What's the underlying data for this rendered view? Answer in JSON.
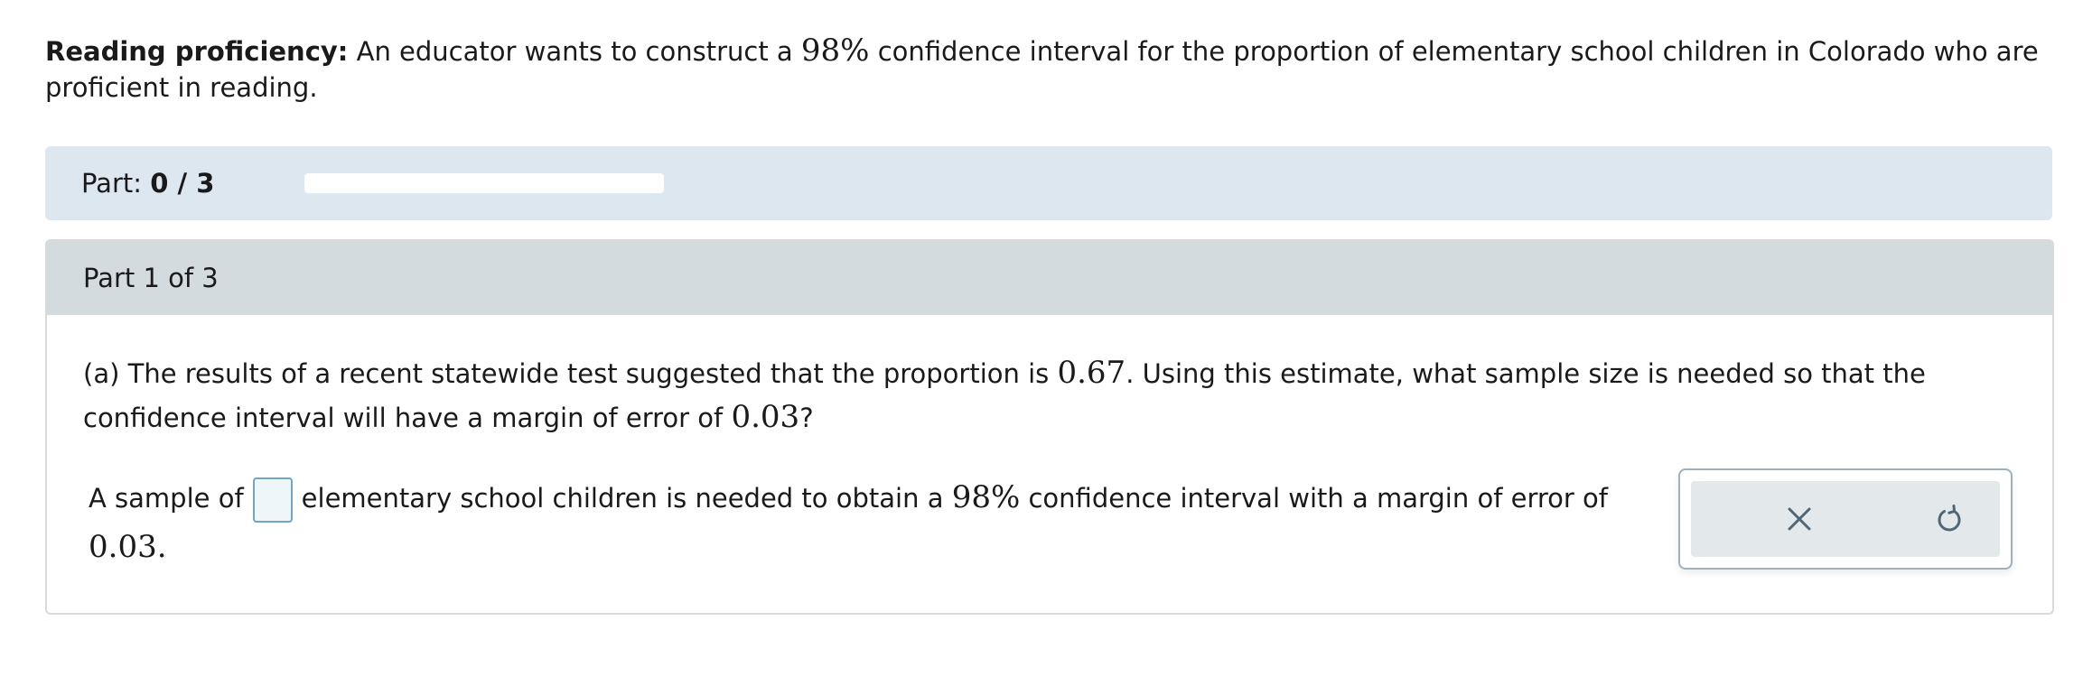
{
  "intro": {
    "lead": "Reading proficiency:",
    "text_1": " An educator wants to construct a ",
    "confidence": "98%",
    "text_2": " confidence interval for the proportion of elementary school children in Colorado who are proficient in reading."
  },
  "part_progress": {
    "label": "Part: ",
    "value": "0 / 3",
    "fraction_complete": 0
  },
  "part": {
    "header": "Part 1 of 3",
    "question": {
      "text_1": "(a) The results of a recent statewide test suggested that the proportion is ",
      "proportion": "0.67",
      "text_2": ". Using this estimate, what sample size is needed so that the confidence interval will have a margin of error of ",
      "margin": "0.03",
      "text_3": "?"
    },
    "answer": {
      "text_1": "A sample of",
      "input_value": "",
      "text_2": "elementary school children is needed to obtain a ",
      "confidence": "98%",
      "text_3": " confidence interval with a margin of error of ",
      "margin": "0.03",
      "text_4": "."
    }
  },
  "tools": {
    "clear_icon": "close-icon",
    "undo_icon": "undo-icon",
    "icon_color": "#4f6674"
  }
}
